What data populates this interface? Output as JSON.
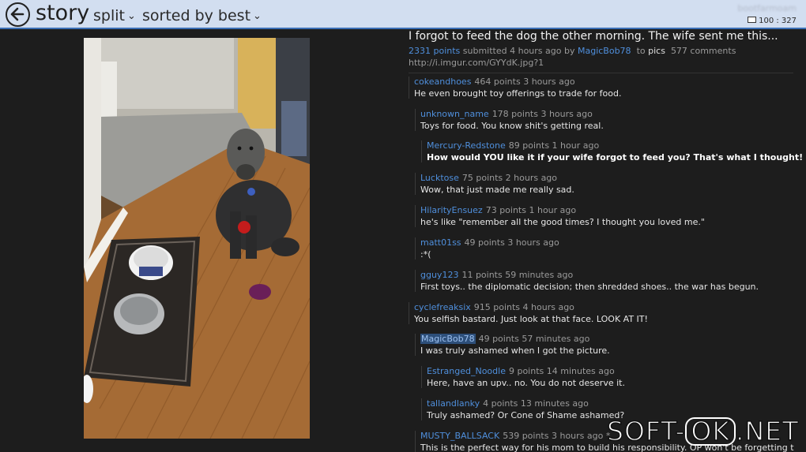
{
  "header": {
    "title": "story",
    "view_mode": "split",
    "sort_mode": "sorted by best",
    "username": "bootfarmoam",
    "karma": "100 : 327"
  },
  "post": {
    "title": "I forgot to feed the dog the other morning. The wife sent me this...",
    "points": "2331 points",
    "submitted": "submitted 4 hours ago",
    "by": "by",
    "author": "MagicBob78",
    "to": "to",
    "subreddit": "pics",
    "comments": "577 comments",
    "url": "http://i.imgur.com/GYYdK.jpg?1"
  },
  "comments": [
    {
      "author": "cokeandhoes",
      "meta": "464 points  3 hours ago",
      "body": "He even brought toy offerings to trade for food."
    },
    {
      "author": "unknown_name",
      "meta": "178 points  3 hours ago",
      "body": "Toys for food. You know shit's getting real."
    },
    {
      "author": "Mercury-Redstone",
      "meta": "89 points  1 hour ago",
      "body": "How would YOU like it if your wife forgot to feed you? That's what I thought!"
    },
    {
      "author": "Lucktose",
      "meta": "75 points  2 hours ago",
      "body": "Wow, that just made me really sad."
    },
    {
      "author": "HilarityEnsuez",
      "meta": "73 points  1 hour ago",
      "body": "he's like \"remember all the good times? I thought you loved me.\""
    },
    {
      "author": "matt01ss",
      "meta": "49 points  3 hours ago",
      "body": ":*("
    },
    {
      "author": "gguy123",
      "meta": "11 points  59 minutes ago",
      "body": "First toys.. the diplomatic decision; then shredded shoes.. the war has begun."
    },
    {
      "author": "cyclefreaksix",
      "meta": "915 points  4 hours ago",
      "body": "You selfish bastard. Just look at that face. LOOK AT IT!"
    },
    {
      "author": "MagicBob78",
      "meta": "49 points  57 minutes ago",
      "body": "I was truly ashamed when I got the picture."
    },
    {
      "author": "Estranged_Noodle",
      "meta": "9 points  14 minutes ago",
      "body": "Here, have an upv.. no. You do not deserve it."
    },
    {
      "author": "tallandlanky",
      "meta": "4 points  13 minutes ago",
      "body": "Truly ashamed? Or Cone of Shame ashamed?"
    },
    {
      "author": "MUSTY_BALLSACK",
      "meta": "539 points  3 hours ago  *",
      "body": "This is the perfect way for his mom to build his responsibility. OP won't be forgetting that face"
    }
  ],
  "watermark": {
    "left": "SOFT-",
    "ok": "OK",
    "right": ".NET"
  }
}
